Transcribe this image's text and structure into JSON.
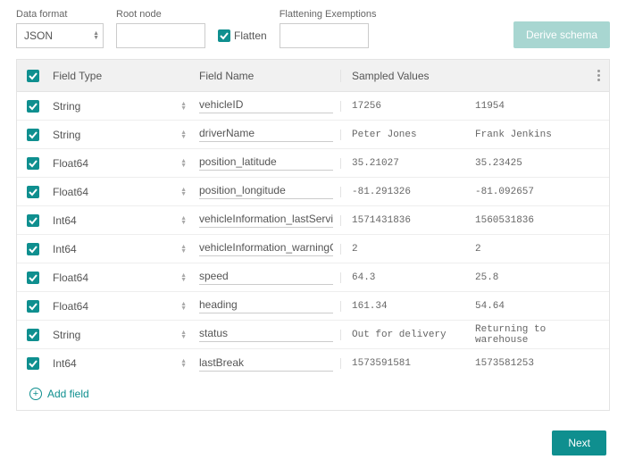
{
  "controls": {
    "data_format_label": "Data format",
    "data_format_value": "JSON",
    "root_node_label": "Root node",
    "root_node_value": "",
    "flatten_label": "Flatten",
    "flatten_checked": true,
    "exemptions_label": "Flattening Exemptions",
    "exemptions_value": "",
    "derive_label": "Derive schema"
  },
  "table": {
    "head_type": "Field Type",
    "head_name": "Field Name",
    "head_sampled": "Sampled Values",
    "rows": [
      {
        "checked": true,
        "type": "String",
        "name": "vehicleID",
        "s1": "17256",
        "s2": "11954"
      },
      {
        "checked": true,
        "type": "String",
        "name": "driverName",
        "s1": "Peter Jones",
        "s2": "Frank Jenkins"
      },
      {
        "checked": true,
        "type": "Float64",
        "name": "position_latitude",
        "s1": "35.21027",
        "s2": "35.23425"
      },
      {
        "checked": true,
        "type": "Float64",
        "name": "position_longitude",
        "s1": "-81.291326",
        "s2": "-81.092657"
      },
      {
        "checked": true,
        "type": "Int64",
        "name": "vehicleInformation_lastService",
        "s1": "1571431836",
        "s2": "1560531836"
      },
      {
        "checked": true,
        "type": "Int64",
        "name": "vehicleInformation_warningCod",
        "s1": "2",
        "s2": "2"
      },
      {
        "checked": true,
        "type": "Float64",
        "name": "speed",
        "s1": "64.3",
        "s2": "25.8"
      },
      {
        "checked": true,
        "type": "Float64",
        "name": "heading",
        "s1": "161.34",
        "s2": "54.64"
      },
      {
        "checked": true,
        "type": "String",
        "name": "status",
        "s1": "Out for delivery",
        "s2": "Returning to warehouse"
      },
      {
        "checked": true,
        "type": "Int64",
        "name": "lastBreak",
        "s1": "1573591581",
        "s2": "1573581253"
      }
    ],
    "add_label": "Add field"
  },
  "footer": {
    "next_label": "Next"
  }
}
